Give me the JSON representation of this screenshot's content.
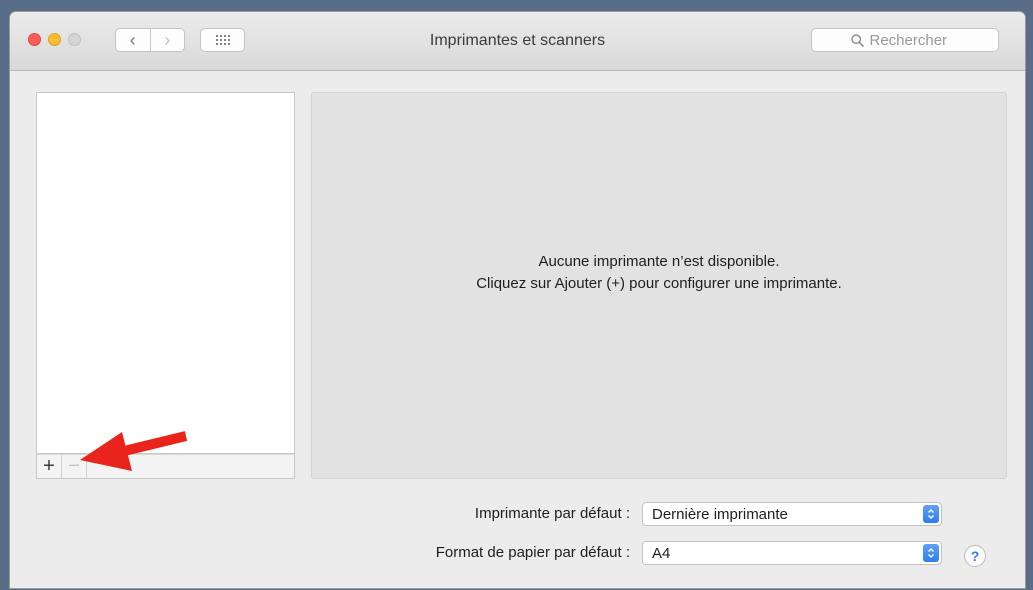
{
  "window": {
    "title": "Imprimantes et scanners"
  },
  "toolbar": {
    "back_glyph": "‹",
    "forward_glyph": "›",
    "grid_icon": "show-all-grid-icon"
  },
  "search": {
    "placeholder": "Rechercher",
    "value": ""
  },
  "printer_list": {
    "items": [],
    "add_label": "+",
    "remove_label": "−"
  },
  "detail": {
    "empty_line1": "Aucune imprimante n’est disponible.",
    "empty_line2": "Cliquez sur Ajouter (+) pour configurer une imprimante."
  },
  "defaults": {
    "printer_label": "Imprimante par défaut :",
    "printer_value": "Dernière imprimante",
    "paper_label": "Format de papier par défaut :",
    "paper_value": "A4"
  },
  "help": {
    "label": "?"
  },
  "colors": {
    "close": "#fc5f57",
    "minimize": "#fdbc2e",
    "zoom_disabled": "#d5d5d5",
    "popup_accent": "#2f7cec",
    "annotation_arrow": "#e8241c"
  }
}
